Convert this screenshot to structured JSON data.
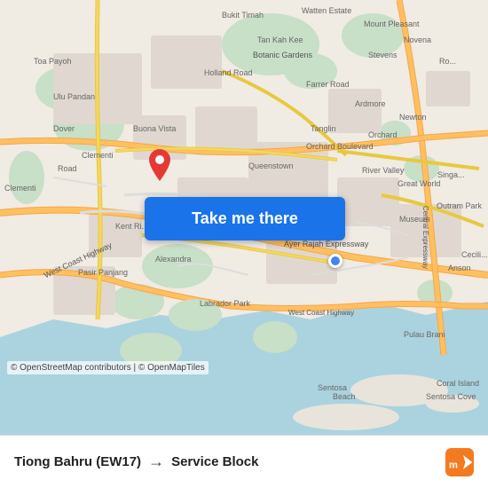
{
  "map": {
    "attribution": "© OpenStreetMap contributors | © OpenMapTiles",
    "take_me_there_label": "Take me there"
  },
  "route": {
    "from": "Tiong Bahru (EW17)",
    "to": "Service Block",
    "arrow": "→"
  },
  "branding": {
    "name": "moovit",
    "logo_alt": "moovit logo"
  }
}
